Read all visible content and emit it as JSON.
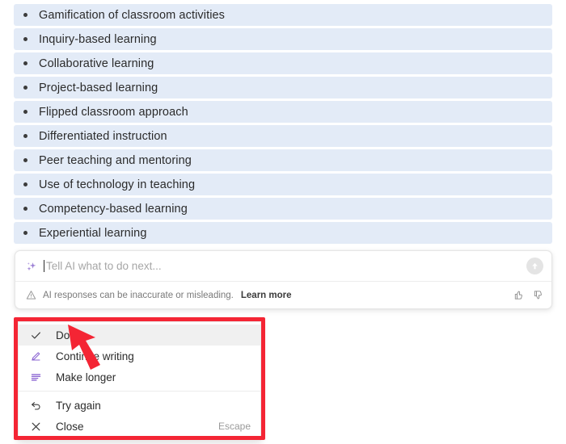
{
  "document": {
    "list_items": [
      "Gamification of classroom activities",
      "Inquiry-based learning",
      "Collaborative learning",
      "Project-based learning",
      "Flipped classroom approach",
      "Differentiated instruction",
      "Peer teaching and mentoring",
      "Use of technology in teaching",
      "Competency-based learning",
      "Experiential learning"
    ]
  },
  "ai_bar": {
    "sparkle_icon": "sparkle-icon",
    "placeholder": "Tell AI what to do next...",
    "input_value": "",
    "send_icon": "arrow-up-circle-icon",
    "warning_icon": "warning-triangle-icon",
    "disclaimer": "AI responses can be inaccurate or misleading.",
    "learn_more": "Learn more",
    "thumbs_up_icon": "thumbs-up-icon",
    "thumbs_down_icon": "thumbs-down-icon"
  },
  "context_menu": {
    "items": [
      {
        "label": "Done",
        "icon": "check-icon",
        "shortcut": "",
        "active": true
      },
      {
        "label": "Continue writing",
        "icon": "pencil-icon",
        "shortcut": "",
        "active": false
      },
      {
        "label": "Make longer",
        "icon": "lines-icon",
        "shortcut": "",
        "active": false
      },
      {
        "label": "Try again",
        "icon": "undo-icon",
        "shortcut": "",
        "active": false
      },
      {
        "label": "Close",
        "icon": "close-x-icon",
        "shortcut": "Escape",
        "active": false
      }
    ],
    "separator_after_index": 2
  },
  "annotation": {
    "highlight_box_color": "#f42534",
    "arrow_color": "#f42534",
    "arrow_icon": "red-pointer-arrow"
  },
  "colors": {
    "row_background": "#e3ebf7",
    "accent_purple": "#8a63d2",
    "text_primary": "#2b2b2b",
    "text_muted": "#7a7a7a"
  }
}
